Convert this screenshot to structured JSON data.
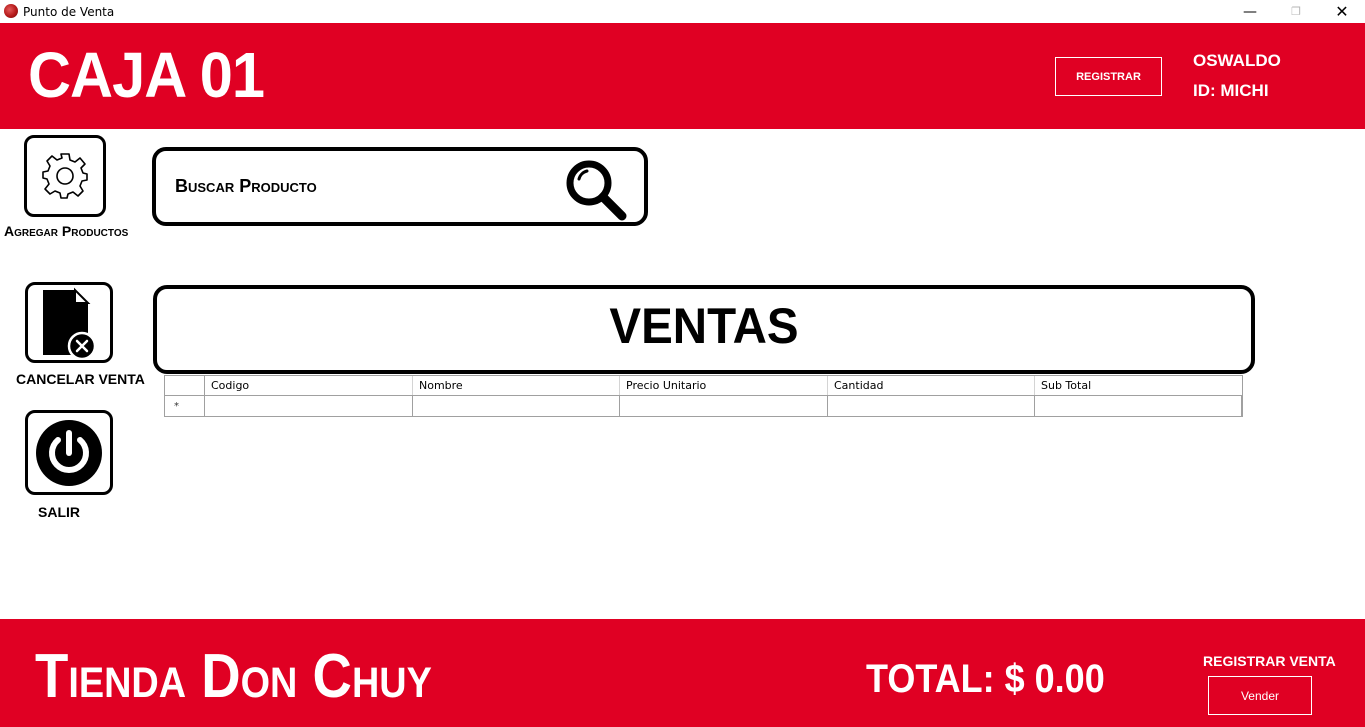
{
  "window": {
    "title": "Punto de Venta",
    "minimize_glyph": "—",
    "maximize_glyph": "❐",
    "close_glyph": "✕"
  },
  "header": {
    "caja_title": "CAJA 01",
    "registrar_label": "Registrar",
    "user_name": "OSWALDO",
    "user_id": "ID: MICHI"
  },
  "sidebar": {
    "add_products_label": "Agregar Productos",
    "cancel_sale_label": "CANCELAR VENTA",
    "exit_label": "SALIR"
  },
  "search": {
    "label": "Buscar Producto"
  },
  "sales": {
    "banner": "VENTAS",
    "columns": [
      "Codigo",
      "Nombre",
      "Precio Unitario",
      "Cantidad",
      "Sub Total"
    ],
    "new_row_marker": "*"
  },
  "footer": {
    "store_name": "Tienda Don Chuy",
    "total_label": "TOTAL: $ 0.00",
    "register_sale_label": "REGISTRAR VENTA",
    "sell_button": "Vender"
  },
  "colors": {
    "brand_red": "#e00023",
    "text_white": "#ffffff"
  },
  "icons": {
    "app": "app-logo-icon",
    "settings": "gear-icon",
    "cancel": "document-cancel-icon",
    "exit": "power-icon",
    "search": "magnifier-icon"
  }
}
